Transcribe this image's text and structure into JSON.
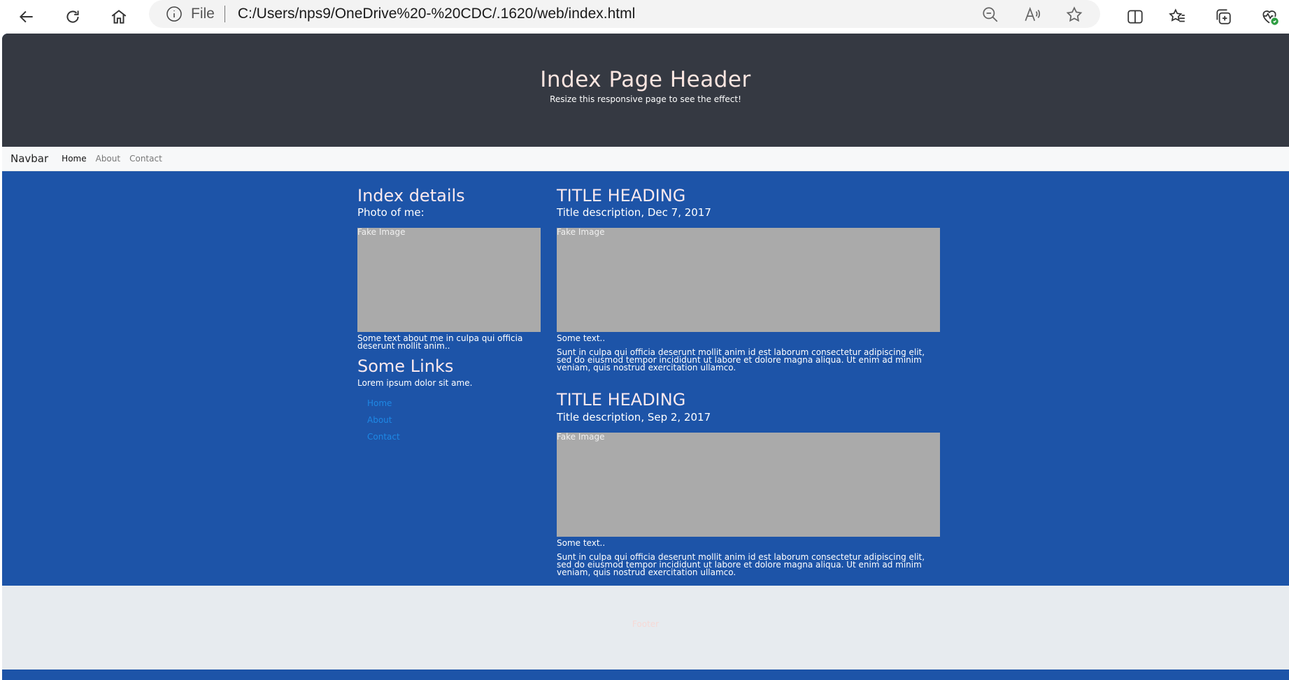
{
  "browser": {
    "address_scheme": "File",
    "url": "C:/Users/nps9/OneDrive%20-%20CDC/.1620/web/index.html"
  },
  "header": {
    "title": "Index Page Header",
    "subtitle": "Resize this responsive page to see the effect!"
  },
  "navbar": {
    "brand": "Navbar",
    "links": [
      "Home",
      "About",
      "Contact"
    ]
  },
  "sidebar": {
    "title": "Index details",
    "photo_label": "Photo of me:",
    "image_label": "Fake Image",
    "about_text": "Some text about me in culpa qui officia deserunt mollit anim..",
    "links_title": "Some Links",
    "links_desc": "Lorem ipsum dolor sit ame.",
    "links": [
      "Home",
      "About",
      "Contact"
    ]
  },
  "posts": [
    {
      "title": "TITLE HEADING",
      "description": "Title description, Dec 7, 2017",
      "image_label": "Fake Image",
      "short_text": "Some text..",
      "body": "Sunt in culpa qui officia deserunt mollit anim id est laborum consectetur adipiscing elit, sed do eiusmod tempor incididunt ut labore et dolore magna aliqua. Ut enim ad minim veniam, quis nostrud exercitation ullamco."
    },
    {
      "title": "TITLE HEADING",
      "description": "Title description, Sep 2, 2017",
      "image_label": "Fake Image",
      "short_text": "Some text..",
      "body": "Sunt in culpa qui officia deserunt mollit anim id est laborum consectetur adipiscing elit, sed do eiusmod tempor incididunt ut labore et dolore magna aliqua. Ut enim ad minim veniam, quis nostrud exercitation ullamco."
    }
  ],
  "footer": {
    "text": "Footer"
  },
  "colors": {
    "page_bg": "#1d54a8",
    "header_bg": "#353942",
    "navbar_bg": "#f7f8f9",
    "image_bg": "#aaaaaa",
    "footer_bg": "#e7ebef",
    "link": "#1e88e5"
  }
}
